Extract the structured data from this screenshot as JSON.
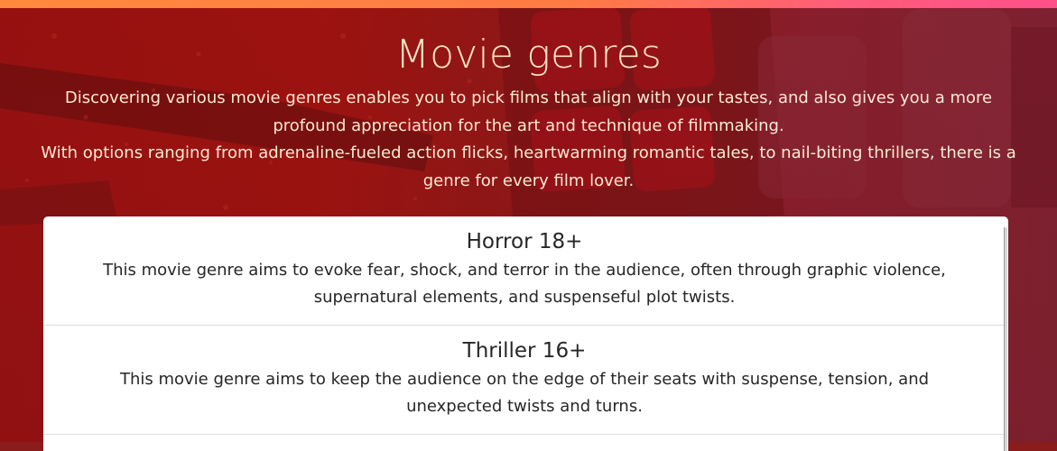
{
  "page": {
    "title": "Movie genres",
    "intro_line_1": "Discovering various movie genres enables you to pick films that align with your tastes, and also gives you a more profound appreciation for the art and technique of filmmaking.",
    "intro_line_2": "With options ranging from adrenaline-fueled action flicks, heartwarming romantic tales, to nail-biting thrillers, there is a genre for every film lover."
  },
  "genres": [
    {
      "title": "Horror 18+",
      "description": "This movie genre aims to evoke fear, shock, and terror in the audience, often through graphic violence, supernatural elements, and suspenseful plot twists."
    },
    {
      "title": "Thriller 16+",
      "description": "This movie genre aims to keep the audience on the edge of their seats with suspense, tension, and unexpected twists and turns."
    }
  ],
  "colors": {
    "accent_strip_start": "#ff8a3d",
    "accent_strip_end": "#ff4f8b",
    "hero_text": "#fde3c0",
    "card_bg": "#ffffff",
    "card_text": "#262626"
  }
}
